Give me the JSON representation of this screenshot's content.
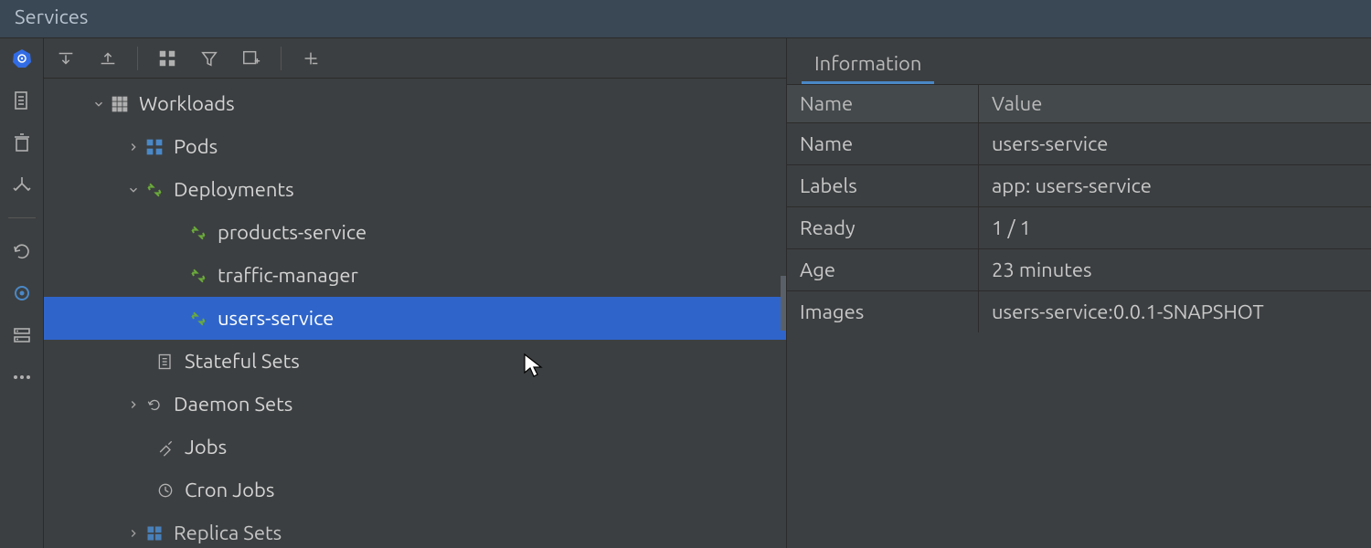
{
  "title": "Services",
  "info_tab": "Information",
  "grid_headers": {
    "name": "Name",
    "value": "Value"
  },
  "info_rows": [
    {
      "name": "Name",
      "value": "users-service"
    },
    {
      "name": "Labels",
      "value": "app: users-service"
    },
    {
      "name": "Ready",
      "value": "1 / 1"
    },
    {
      "name": "Age",
      "value": "23 minutes"
    },
    {
      "name": "Images",
      "value": "users-service:0.0.1-SNAPSHOT"
    }
  ],
  "tree": {
    "workloads": "Workloads",
    "pods": "Pods",
    "deployments": "Deployments",
    "dep_products": "products-service",
    "dep_traffic": "traffic-manager",
    "dep_users": "users-service",
    "stateful_sets": "Stateful Sets",
    "daemon_sets": "Daemon Sets",
    "jobs": "Jobs",
    "cron_jobs": "Cron Jobs",
    "replica_sets": "Replica Sets"
  }
}
